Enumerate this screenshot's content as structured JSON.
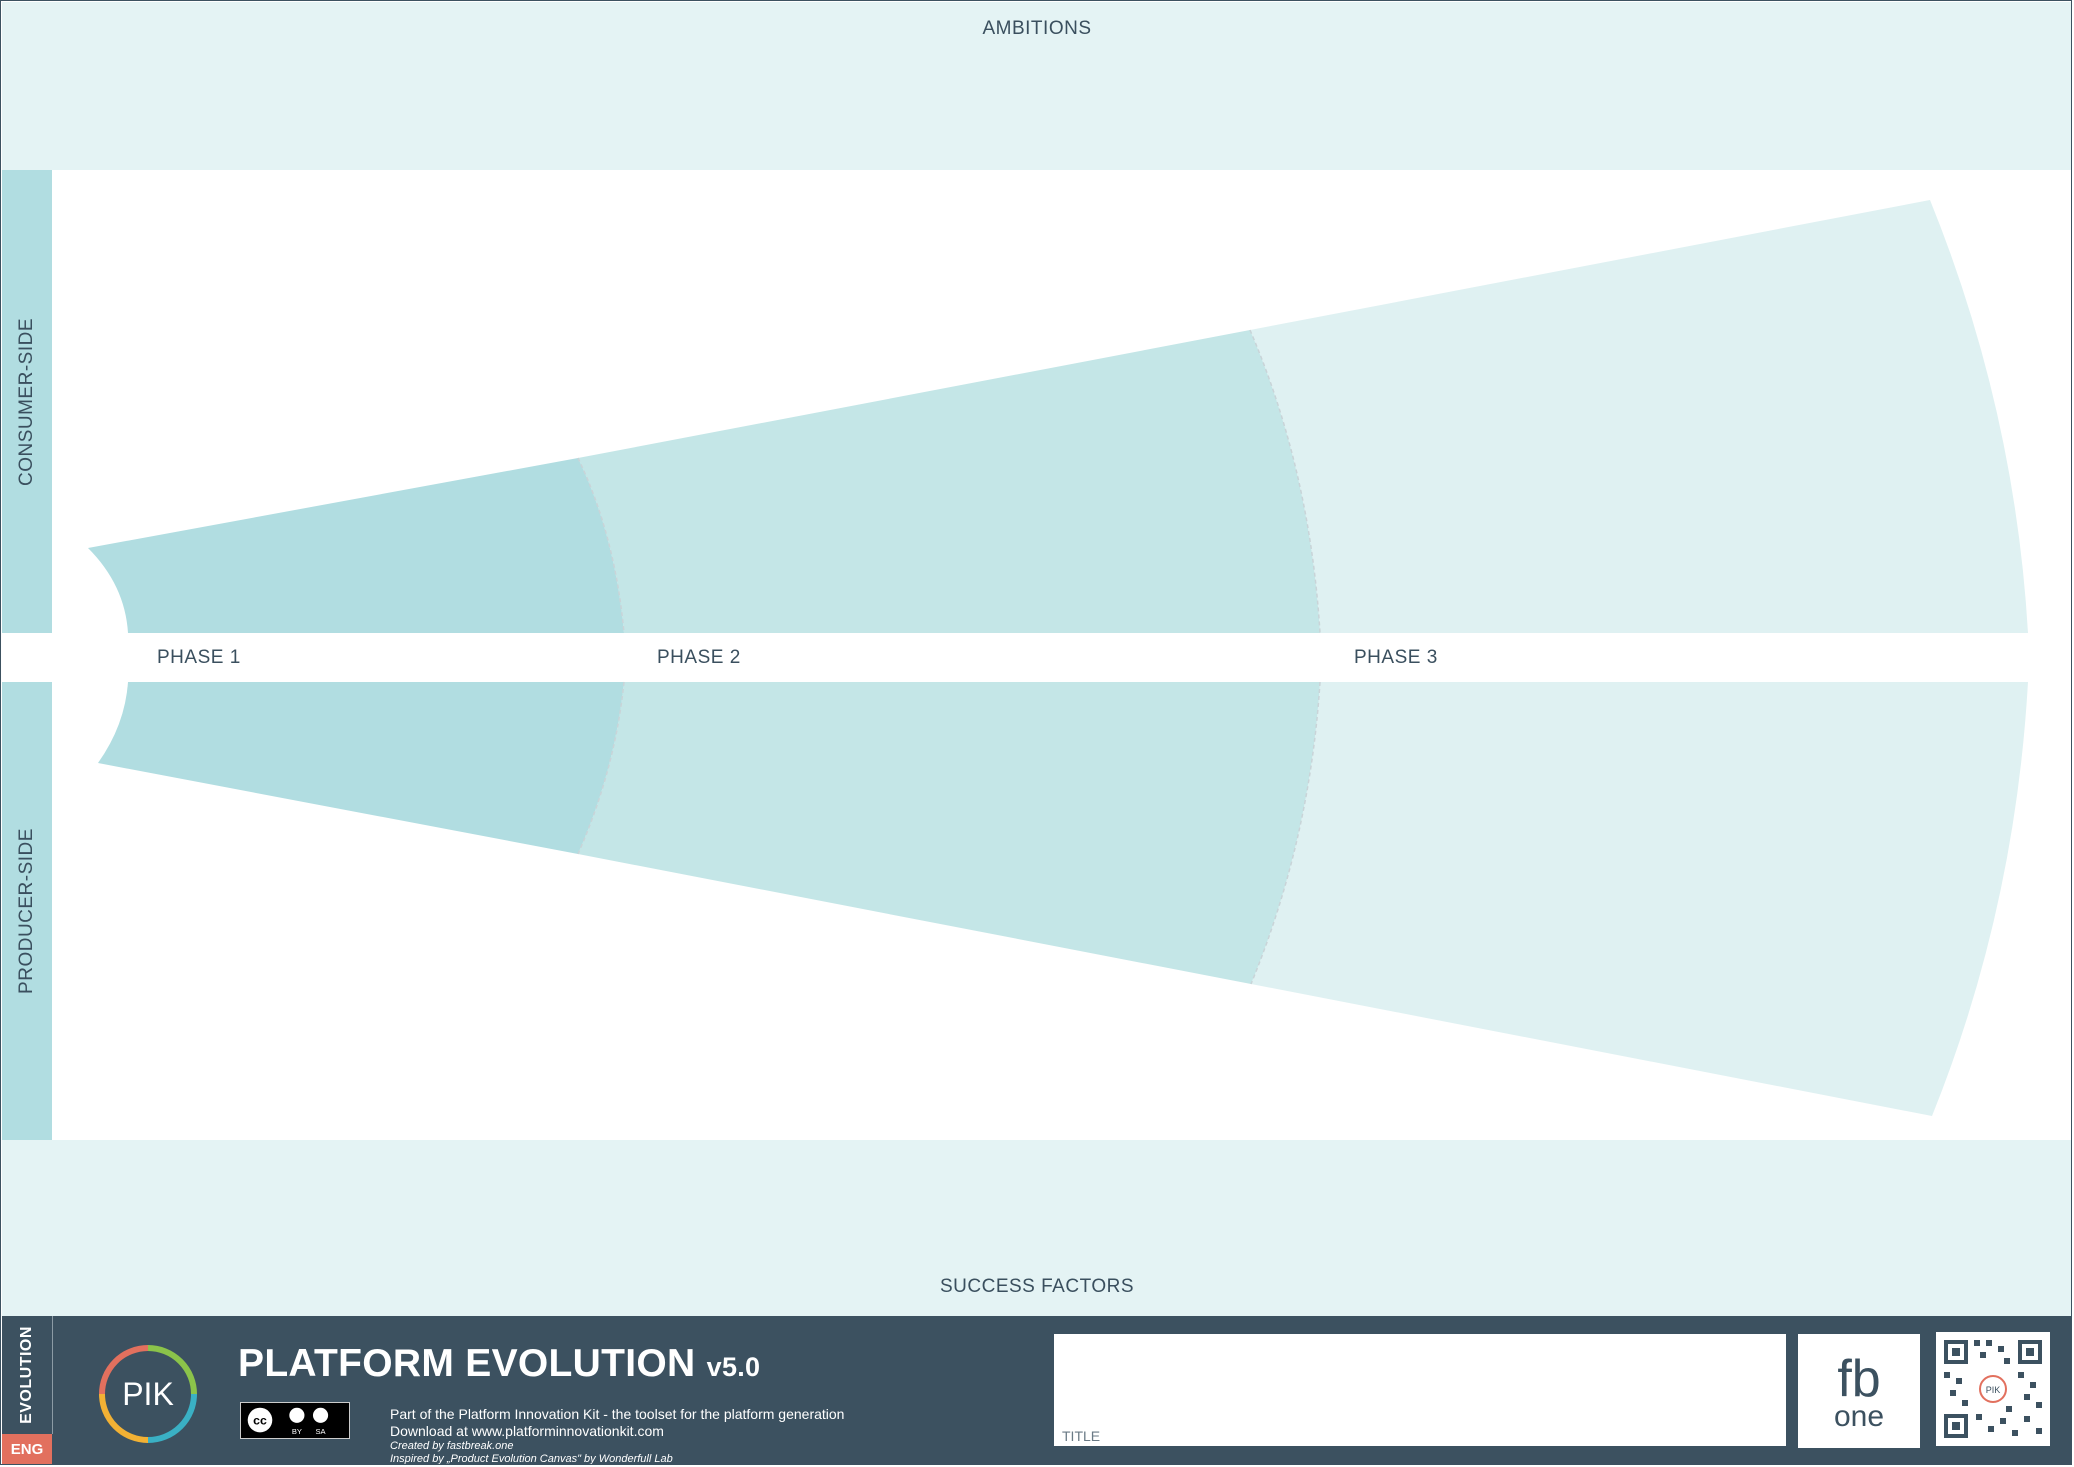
{
  "canvas": {
    "ambitions_label": "AMBITIONS",
    "success_factors_label": "SUCCESS FACTORS",
    "consumer_side_label": "CONSUMER-SIDE",
    "producer_side_label": "PRODUCER-SIDE",
    "phases": [
      "PHASE 1",
      "PHASE 2",
      "PHASE 3"
    ]
  },
  "footer": {
    "section_label": "EVOLUTION",
    "language": "ENG",
    "logo_text": "PIK",
    "title": "PLATFORM EVOLUTION",
    "version": "v5.0",
    "license_badge": {
      "by": "BY",
      "sa": "SA"
    },
    "info_line_1": "Part of the Platform Innovation Kit  - the toolset for the platform generation",
    "info_line_2": "Download at www.platforminnovationkit.com",
    "created_by": "Created by fastbreak.one",
    "inspired_by": "Inspired by „Product Evolution Canvas\" by Wonderfull Lab",
    "title_field_label": "TITLE",
    "fb_logo_top": "fb",
    "fb_logo_bottom": "one",
    "qr_center": "PIK"
  },
  "colors": {
    "footer_bg": "#3c5160",
    "band_bg": "#e4f3f4",
    "side_bar": "#b1dde1",
    "phase1": "#b1dde1",
    "phase2": "#c4e6e7",
    "phase3": "#dff1f2",
    "lang_badge": "#e2705e",
    "text": "#3a4f5e"
  }
}
